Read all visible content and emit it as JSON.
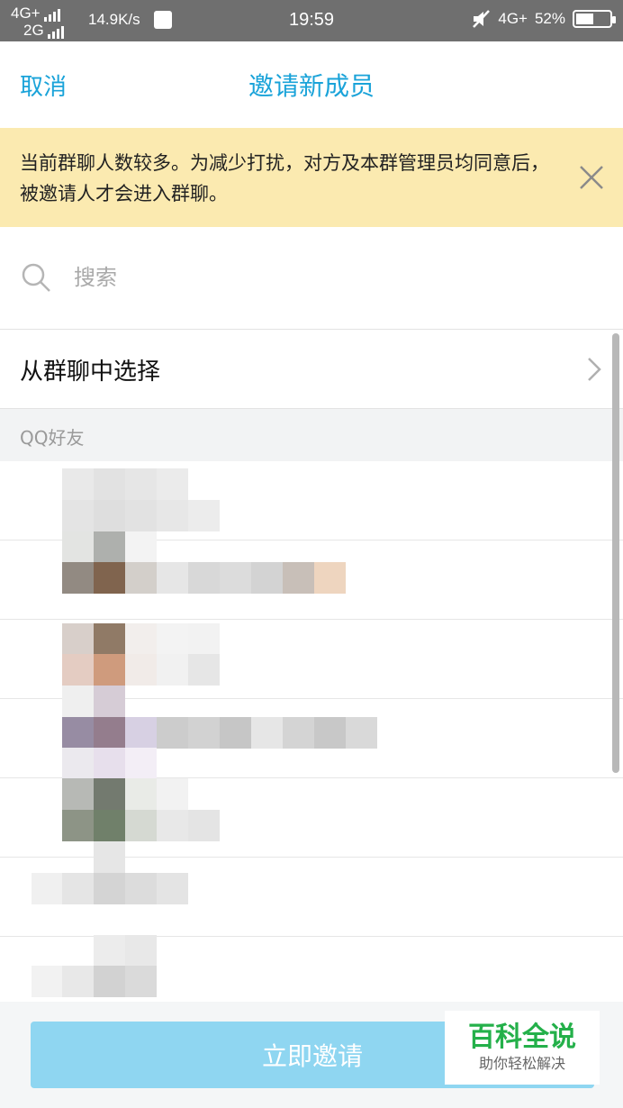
{
  "status_bar": {
    "network_top": "4G+",
    "network_bottom": "2G",
    "speed": "14.9K/s",
    "time": "19:59",
    "network_right": "4G+",
    "battery": "52%",
    "battery_level": 0.52
  },
  "nav": {
    "cancel": "取消",
    "title": "邀请新成员"
  },
  "notice": {
    "text": "当前群聊人数较多。为减少打扰，对方及本群管理员均同意后，被邀请人才会进入群聊。"
  },
  "search": {
    "placeholder": "搜索"
  },
  "from_group": {
    "label": "从群聊中选择"
  },
  "section": {
    "label": "QQ好友"
  },
  "invite_button": {
    "label": "立即邀请"
  },
  "watermark": {
    "title": "百科全说",
    "subtitle": "助你轻松解决"
  },
  "colors": {
    "accent": "#1aa3d9",
    "notice_bg": "#fbeab0",
    "invite_bg": "#8fd6f1",
    "watermark_green": "#24b04a"
  }
}
